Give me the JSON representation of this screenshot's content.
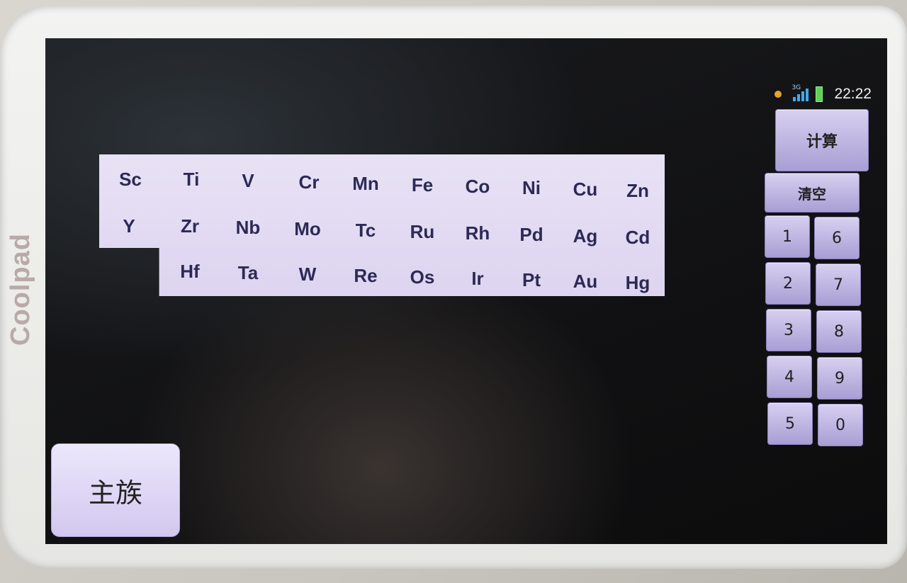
{
  "device": {
    "brand": "Coolpad"
  },
  "status_bar": {
    "network": "3G",
    "time": "22:22"
  },
  "element_table": {
    "rows": [
      [
        "Sc",
        "Ti",
        "V",
        "Cr",
        "Mn",
        "Fe",
        "Co",
        "Ni",
        "Cu",
        "Zn"
      ],
      [
        "Y",
        "Zr",
        "Nb",
        "Mo",
        "Tc",
        "Ru",
        "Rh",
        "Pd",
        "Ag",
        "Cd"
      ],
      [
        "",
        "Hf",
        "Ta",
        "W",
        "Re",
        "Os",
        "Ir",
        "Pt",
        "Au",
        "Hg"
      ]
    ]
  },
  "buttons": {
    "calculate": "计算",
    "clear": "清空",
    "main_group": "主族",
    "digits": [
      "1",
      "2",
      "3",
      "4",
      "5",
      "6",
      "7",
      "8",
      "9",
      "0"
    ]
  }
}
